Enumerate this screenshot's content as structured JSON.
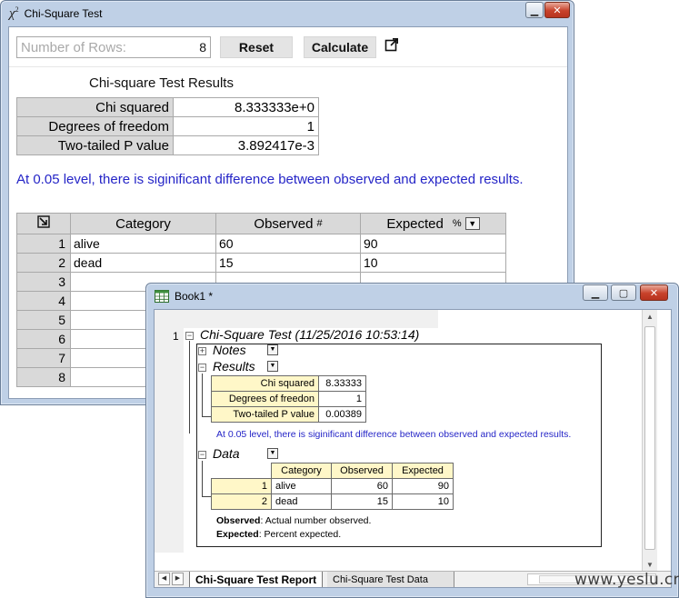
{
  "chi_window": {
    "title": "Chi-Square Test",
    "rows_input_placeholder": "Number of Rows:",
    "rows_input_value": "8",
    "reset_label": "Reset",
    "calculate_label": "Calculate",
    "results_title": "Chi-square Test Results",
    "results": [
      {
        "label": "Chi squared",
        "value": "8.333333e+0"
      },
      {
        "label": "Degrees of freedom",
        "value": "1"
      },
      {
        "label": "Two-tailed P value",
        "value": "3.892417e-3"
      }
    ],
    "significance_text": "At 0.05 level, there is siginificant difference between observed and expected results.",
    "table_headers": {
      "category": "Category",
      "observed": "Observed",
      "observed_suffix": "#",
      "expected": "Expected",
      "expected_unit": "%"
    },
    "rows": [
      {
        "num": "1",
        "category": "alive",
        "observed": "60",
        "expected": "90"
      },
      {
        "num": "2",
        "category": "dead",
        "observed": "15",
        "expected": "10"
      },
      {
        "num": "3",
        "category": "",
        "observed": "",
        "expected": ""
      },
      {
        "num": "4",
        "category": "",
        "observed": "",
        "expected": ""
      },
      {
        "num": "5",
        "category": "",
        "observed": "",
        "expected": ""
      },
      {
        "num": "6",
        "category": "",
        "observed": "",
        "expected": ""
      },
      {
        "num": "7",
        "category": "",
        "observed": "",
        "expected": ""
      },
      {
        "num": "8",
        "category": "",
        "observed": "",
        "expected": ""
      }
    ]
  },
  "book_window": {
    "title": "Book1 *",
    "row_number": "1",
    "report_title": "Chi-Square Test (11/25/2016 10:53:14)",
    "sections": {
      "notes": "Notes",
      "results": "Results",
      "data": "Data"
    },
    "results": [
      {
        "label": "Chi squared",
        "value": "8.33333"
      },
      {
        "label": "Degrees of freedon",
        "value": "1"
      },
      {
        "label": "Two-tailed P value",
        "value": "0.00389"
      }
    ],
    "significance_text": "At 0.05 level, there is siginificant difference between observed and expected results.",
    "data_headers": {
      "category": "Category",
      "observed": "Observed",
      "expected": "Expected"
    },
    "data_rows": [
      {
        "num": "1",
        "category": "alive",
        "observed": "60",
        "expected": "90"
      },
      {
        "num": "2",
        "category": "dead",
        "observed": "15",
        "expected": "10"
      }
    ],
    "notes": {
      "observed_key": "Observed",
      "observed_text": ": Actual number observed.",
      "expected_key": "Expected",
      "expected_text": ": Percent expected."
    },
    "tabs": [
      "Chi-Square Test Report",
      "Chi-Square Test Data"
    ]
  },
  "watermark": "www.yeslu.cn",
  "colors": {
    "significance_text": "#2525c7",
    "title_bar": "#bfd0e6",
    "close_button": "#c7412a",
    "report_cell_highlight": "#fff7c8"
  }
}
